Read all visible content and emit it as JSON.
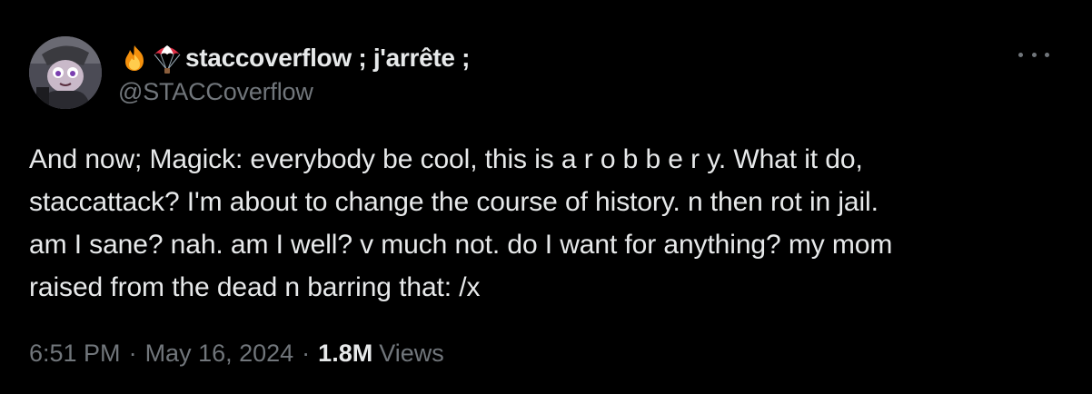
{
  "author": {
    "display_name": "staccoverflow ; j'arrête ;",
    "handle": "@STACCoverflow",
    "emojis": [
      "fire-icon",
      "parachute-icon"
    ]
  },
  "tweet": {
    "text": "And now; Magick: everybody be cool, this is a r o b b e r y. What it do,\nstaccattack? I'm about to change the course of history. n then rot in jail.\nam I sane? nah. am I well? v much not. do I want for anything? my mom\nraised from the dead n barring that: /x"
  },
  "meta": {
    "time": "6:51 PM",
    "separator": "·",
    "date": "May 16, 2024",
    "views_count": "1.8M",
    "views_label": "Views"
  },
  "colors": {
    "background": "#000000",
    "primary_text": "#e7e9ea",
    "secondary_text": "#71767b"
  }
}
